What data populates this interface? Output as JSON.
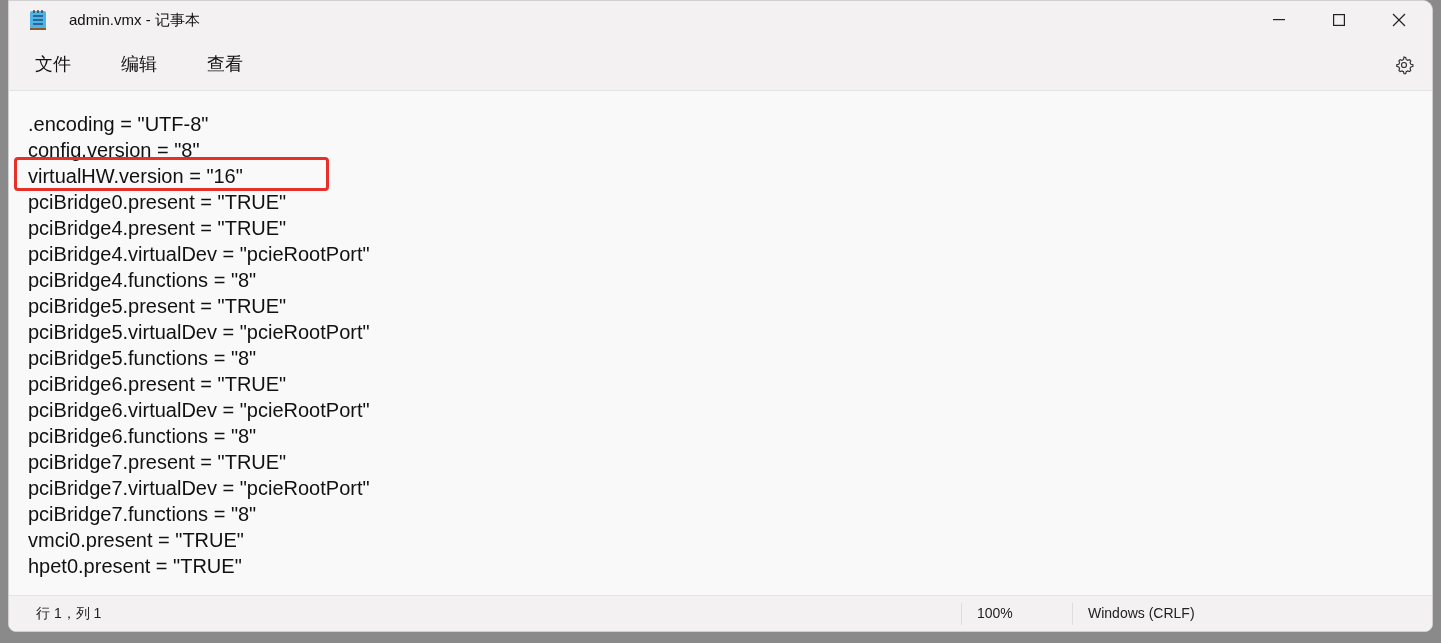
{
  "window": {
    "title": "admin.vmx - 记事本"
  },
  "menu": [
    {
      "label": "文件"
    },
    {
      "label": "编辑"
    },
    {
      "label": "查看"
    }
  ],
  "editor": {
    "lines": [
      {
        "text": ".encoding = \"UTF-8\"",
        "highlighted": false
      },
      {
        "text": "config.version = \"8\"",
        "highlighted": false
      },
      {
        "text": "virtualHW.version = \"16\"",
        "highlighted": true
      },
      {
        "text": "pciBridge0.present = \"TRUE\"",
        "highlighted": false
      },
      {
        "text": "pciBridge4.present = \"TRUE\"",
        "highlighted": false
      },
      {
        "text": "pciBridge4.virtualDev = \"pcieRootPort\"",
        "highlighted": false
      },
      {
        "text": "pciBridge4.functions = \"8\"",
        "highlighted": false
      },
      {
        "text": "pciBridge5.present = \"TRUE\"",
        "highlighted": false
      },
      {
        "text": "pciBridge5.virtualDev = \"pcieRootPort\"",
        "highlighted": false
      },
      {
        "text": "pciBridge5.functions = \"8\"",
        "highlighted": false
      },
      {
        "text": "pciBridge6.present = \"TRUE\"",
        "highlighted": false
      },
      {
        "text": "pciBridge6.virtualDev = \"pcieRootPort\"",
        "highlighted": false
      },
      {
        "text": "pciBridge6.functions = \"8\"",
        "highlighted": false
      },
      {
        "text": "pciBridge7.present = \"TRUE\"",
        "highlighted": false
      },
      {
        "text": "pciBridge7.virtualDev = \"pcieRootPort\"",
        "highlighted": false
      },
      {
        "text": "pciBridge7.functions = \"8\"",
        "highlighted": false
      },
      {
        "text": "vmci0.present = \"TRUE\"",
        "highlighted": false
      },
      {
        "text": "hpet0.present = \"TRUE\"",
        "highlighted": false
      }
    ]
  },
  "status_bar": {
    "position": "行 1，列 1",
    "zoom": "100%",
    "line_ending": "Windows (CRLF)"
  }
}
